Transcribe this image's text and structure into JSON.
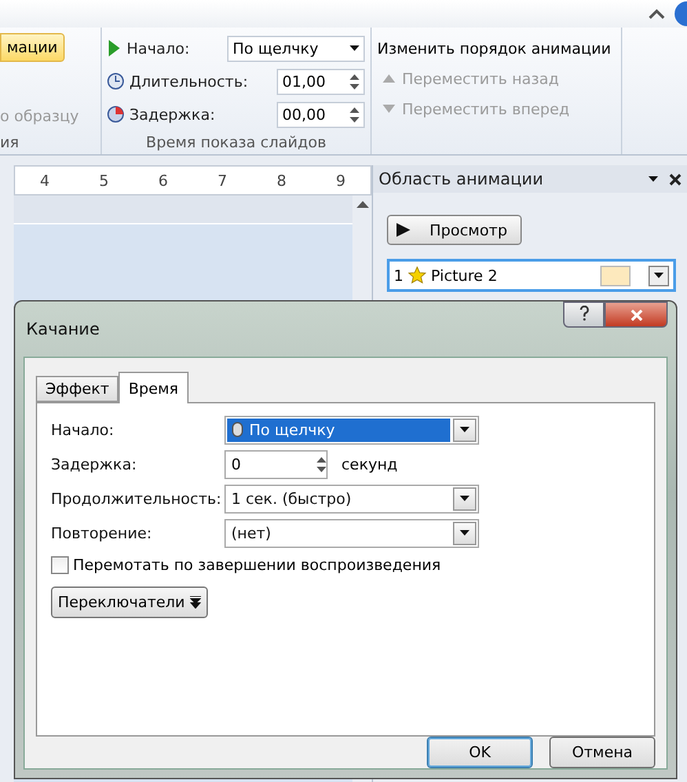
{
  "ribbon": {
    "left_group": {
      "button": "мации",
      "item": "о образцу",
      "label": "ия"
    },
    "timing": {
      "label": "Время показа слайдов",
      "rows": [
        {
          "kind": "select",
          "label": "Начало:",
          "value": "По щелчку"
        },
        {
          "kind": "spin",
          "label": "Длительность:",
          "value": "01,00"
        },
        {
          "kind": "spin",
          "label": "Задержка:",
          "value": "00,00"
        }
      ]
    },
    "reorder": {
      "title": "Изменить порядок анимации",
      "items": [
        {
          "label": "Переместить назад",
          "disabled": true
        },
        {
          "label": "Переместить вперед",
          "disabled": true
        }
      ]
    }
  },
  "ruler": {
    "marks": [
      "4",
      "5",
      "6",
      "7",
      "8",
      "9"
    ]
  },
  "animation_pane": {
    "title": "Область анимации",
    "preview_button": "Просмотр",
    "items": [
      {
        "number": "1",
        "name": "Picture 2",
        "color": "#fde9bd",
        "selected": true
      }
    ]
  },
  "dialog": {
    "title": "Качание",
    "tabs": [
      {
        "label": "Эффект",
        "selected": false
      },
      {
        "label": "Время",
        "selected": true
      }
    ],
    "fields": [
      {
        "kind": "combo",
        "label": "Начало:",
        "value": "По щелчку",
        "selected": true
      },
      {
        "kind": "spin",
        "label": "Задержка:",
        "value": "0",
        "unit": "секунд"
      },
      {
        "kind": "combo",
        "label": "Продолжительность:",
        "value": "1 сек. (быстро)",
        "selected": false
      },
      {
        "kind": "combo",
        "label": "Повторение:",
        "value": "(нет)",
        "selected": false
      }
    ],
    "checkbox": {
      "label": "Перемотать по завершении воспроизведения",
      "checked": false
    },
    "triggers_button": "Переключатели",
    "buttons": [
      {
        "label": "OK",
        "default": true
      },
      {
        "label": "Отмена",
        "default": false
      }
    ]
  }
}
